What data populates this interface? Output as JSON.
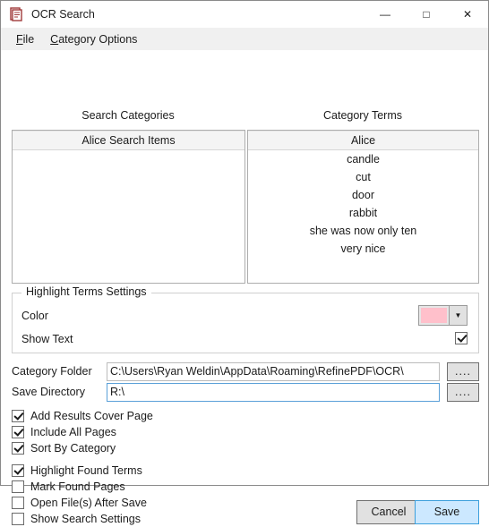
{
  "window": {
    "title": "OCR Search",
    "icon": "document-icon",
    "controls": {
      "minimize": "—",
      "maximize": "□",
      "close": "✕"
    }
  },
  "menubar": {
    "items": [
      {
        "label": "File",
        "mnemonic": "F"
      },
      {
        "label": "Category Options",
        "mnemonic": "C"
      }
    ]
  },
  "lists": {
    "left": {
      "header_label": "Search Categories",
      "items": [
        {
          "text": "Alice Search Items",
          "selected": true
        }
      ]
    },
    "right": {
      "header_label": "Category Terms",
      "items": [
        {
          "text": "Alice",
          "selected": true
        },
        {
          "text": "candle",
          "selected": false
        },
        {
          "text": "cut",
          "selected": false
        },
        {
          "text": "door",
          "selected": false
        },
        {
          "text": "rabbit",
          "selected": false
        },
        {
          "text": "she was now only ten",
          "selected": false
        },
        {
          "text": "very nice",
          "selected": false
        }
      ]
    }
  },
  "highlight_group": {
    "title": "Highlight Terms Settings",
    "color_label": "Color",
    "color_value": "#ffc0cb",
    "color_dropdown_icon": "chevron-down-icon",
    "show_text_label": "Show Text",
    "show_text_checked": true
  },
  "paths": {
    "category_folder": {
      "label": "Category Folder",
      "value": "C:\\Users\\Ryan Weldin\\AppData\\Roaming\\RefinePDF\\OCR\\",
      "placeholder": "",
      "browse_label": "....",
      "focused": false
    },
    "save_directory": {
      "label": "Save Directory",
      "value": "R:\\",
      "placeholder": "",
      "browse_label": "....",
      "focused": true
    }
  },
  "options": [
    {
      "label": "Add Results Cover Page",
      "checked": true
    },
    {
      "label": "Include All Pages",
      "checked": true
    },
    {
      "label": "Sort By Category",
      "checked": true
    },
    {
      "label": "Highlight Found Terms",
      "checked": true
    },
    {
      "label": "Mark Found Pages",
      "checked": false
    },
    {
      "label": "Open File(s) After Save",
      "checked": false
    },
    {
      "label": "Show Search Settings",
      "checked": false
    }
  ],
  "buttons": {
    "cancel": "Cancel",
    "save": "Save"
  }
}
